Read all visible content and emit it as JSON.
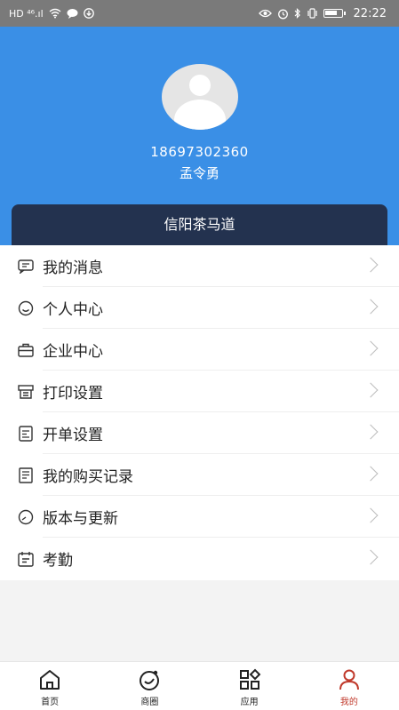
{
  "status_bar": {
    "left_text": "HD ⁴⁶.ıl",
    "time": "22:22",
    "battery_level": 0.75
  },
  "profile": {
    "phone": "18697302360",
    "name": "孟令勇",
    "company": "信阳茶马道"
  },
  "menu": [
    {
      "label": "我的消息",
      "icon": "message-icon"
    },
    {
      "label": "个人中心",
      "icon": "smile-icon"
    },
    {
      "label": "企业中心",
      "icon": "briefcase-icon"
    },
    {
      "label": "打印设置",
      "icon": "printer-icon"
    },
    {
      "label": "开单设置",
      "icon": "form-icon"
    },
    {
      "label": "我的购买记录",
      "icon": "document-icon"
    },
    {
      "label": "版本与更新",
      "icon": "clock-icon"
    },
    {
      "label": "考勤",
      "icon": "calendar-icon"
    }
  ],
  "tabbar": [
    {
      "label": "首页",
      "icon": "home-icon"
    },
    {
      "label": "商圈",
      "icon": "planet-icon"
    },
    {
      "label": "应用",
      "icon": "apps-icon"
    },
    {
      "label": "我的",
      "icon": "person-icon",
      "active": true
    }
  ],
  "colors": {
    "header": "#3a8fe6",
    "company_bar": "#23324f",
    "active_tab": "#c0392b"
  }
}
